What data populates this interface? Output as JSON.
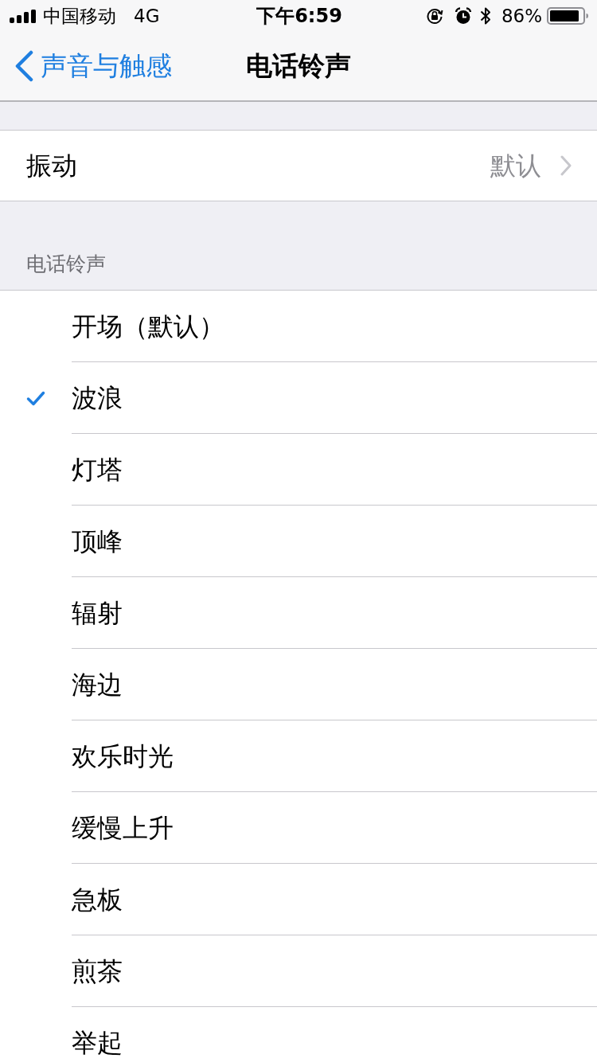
{
  "status_bar": {
    "carrier": "中国移动",
    "network": "4G",
    "time": "下午6:59",
    "battery": "86%"
  },
  "nav_bar": {
    "back_label": "声音与触感",
    "title": "电话铃声"
  },
  "vibration": {
    "label": "振动",
    "value": "默认"
  },
  "ringtones": {
    "header": "电话铃声",
    "items": [
      {
        "label": "开场（默认）",
        "selected": false
      },
      {
        "label": "波浪",
        "selected": true
      },
      {
        "label": "灯塔",
        "selected": false
      },
      {
        "label": "顶峰",
        "selected": false
      },
      {
        "label": "辐射",
        "selected": false
      },
      {
        "label": "海边",
        "selected": false
      },
      {
        "label": "欢乐时光",
        "selected": false
      },
      {
        "label": "缓慢上升",
        "selected": false
      },
      {
        "label": "急板",
        "selected": false
      },
      {
        "label": "煎茶",
        "selected": false
      },
      {
        "label": "举起",
        "selected": false
      }
    ]
  }
}
